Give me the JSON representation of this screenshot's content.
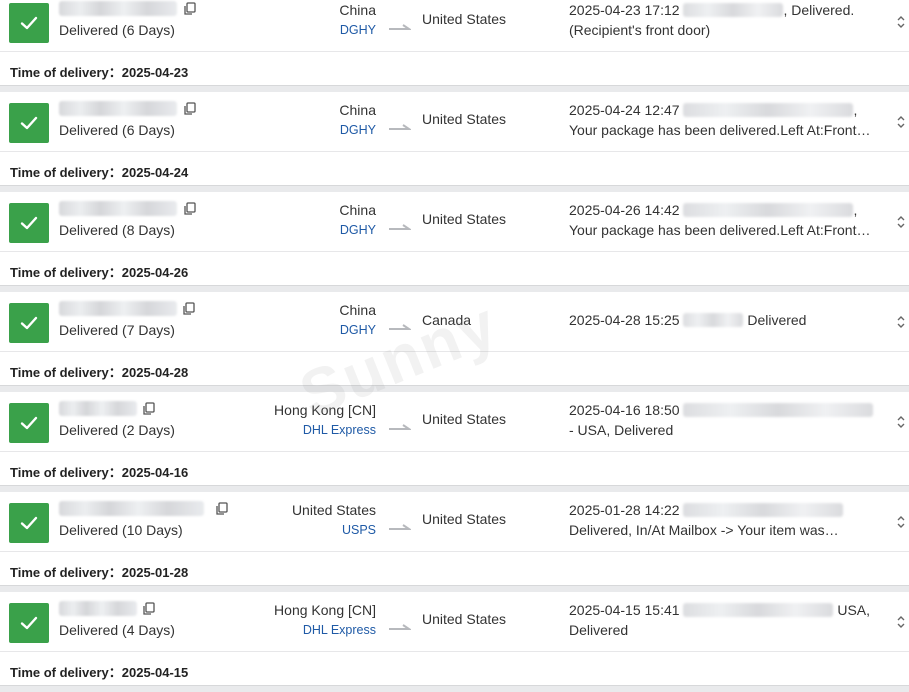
{
  "accent_color": "#3aa14a",
  "carrier_color": "#1f5aa6",
  "watermark": "Sunny",
  "shipments": [
    {
      "status": "Delivered (6 Days)",
      "origin": "China",
      "carrier": "DGHY",
      "destination": "United States",
      "event_line1_time": "2025-04-23 17:12",
      "event_line1_suffix": ", Delivered.",
      "event_line2": "(Recipient's front door)",
      "time_of_delivery_label": "Time of delivery：",
      "time_of_delivery": "2025-04-23"
    },
    {
      "status": "Delivered (6 Days)",
      "origin": "China",
      "carrier": "DGHY",
      "destination": "United States",
      "event_line1_time": "2025-04-24 12:47",
      "event_line1_suffix": ",",
      "event_line2": "Your package has been delivered.Left At:Front…",
      "time_of_delivery_label": "Time of delivery：",
      "time_of_delivery": "2025-04-24"
    },
    {
      "status": "Delivered (8 Days)",
      "origin": "China",
      "carrier": "DGHY",
      "destination": "United States",
      "event_line1_time": "2025-04-26 14:42",
      "event_line1_suffix": ",",
      "event_line2": "Your package has been delivered.Left At:Front…",
      "time_of_delivery_label": "Time of delivery：",
      "time_of_delivery": "2025-04-26"
    },
    {
      "status": "Delivered (7 Days)",
      "origin": "China",
      "carrier": "DGHY",
      "destination": "Canada",
      "event_line1_time": "2025-04-28 15:25",
      "event_line1_suffix": " Delivered",
      "event_line2": "",
      "time_of_delivery_label": "Time of delivery：",
      "time_of_delivery": "2025-04-28"
    },
    {
      "status": "Delivered (2 Days)",
      "origin": "Hong Kong [CN]",
      "carrier": "DHL Express",
      "destination": "United States",
      "event_line1_time": "2025-04-16 18:50",
      "event_line1_suffix": "",
      "event_line2": "- USA, Delivered",
      "time_of_delivery_label": "Time of delivery：",
      "time_of_delivery": "2025-04-16"
    },
    {
      "status": "Delivered (10 Days)",
      "origin": "United States",
      "carrier": "USPS",
      "destination": "United States",
      "event_line1_time": "2025-01-28 14:22",
      "event_line1_suffix": "",
      "event_line2": "Delivered, In/At Mailbox -> Your item was…",
      "time_of_delivery_label": "Time of delivery：",
      "time_of_delivery": "2025-01-28"
    },
    {
      "status": "Delivered (4 Days)",
      "origin": "Hong Kong [CN]",
      "carrier": "DHL Express",
      "destination": "United States",
      "event_line1_time": "2025-04-15 15:41",
      "event_line1_suffix": " USA,",
      "event_line2": "Delivered",
      "time_of_delivery_label": "Time of delivery：",
      "time_of_delivery": "2025-04-15"
    }
  ]
}
